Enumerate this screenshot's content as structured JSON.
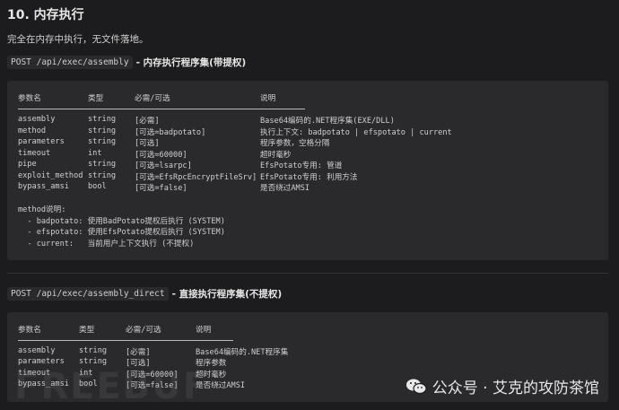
{
  "heading": "10. 内存执行",
  "desc": "完全在内存中执行，无文件落地。",
  "endpoints": [
    {
      "path": "POST /api/exec/assembly",
      "title": "- 内存执行程序集(带提权)",
      "headers": [
        "参数名",
        "类型",
        "必需/可选",
        "说明"
      ],
      "rows": [
        [
          "assembly",
          "string",
          "[必需]",
          "Base64编码的.NET程序集(EXE/DLL)"
        ],
        [
          "method",
          "string",
          "[可选=badpotato]",
          "执行上下文: badpotato | efspotato | current"
        ],
        [
          "parameters",
          "string",
          "[可选]",
          "程序参数，空格分隔"
        ],
        [
          "timeout",
          "int",
          "[可选=60000]",
          "超时毫秒"
        ],
        [
          "pipe",
          "string",
          "[可选=lsarpc]",
          "EfsPotato专用: 管道"
        ],
        [
          "exploit_method",
          "string",
          "[可选=EfsRpcEncryptFileSrv]",
          "EfsPotato专用: 利用方法"
        ],
        [
          "bypass_amsi",
          "bool",
          "[可选=false]",
          "是否绕过AMSI"
        ]
      ],
      "notes": [
        "method说明:",
        "  - badpotato: 使用BadPotato提权后执行 (SYSTEM)",
        "  - efspotato: 使用EfsPotato提权后执行 (SYSTEM)",
        "  - current:   当前用户上下文执行 (不提权)"
      ]
    },
    {
      "path": "POST /api/exec/assembly_direct",
      "title": "- 直接执行程序集(不提权)",
      "headers": [
        "参数名",
        "类型",
        "必需/可选",
        "说明"
      ],
      "rows": [
        [
          "assembly",
          "string",
          "[必需]",
          "Base64编码的.NET程序集"
        ],
        [
          "parameters",
          "string",
          "[可选]",
          "程序参数"
        ],
        [
          "timeout",
          "int",
          "[可选=60000]",
          "超时毫秒"
        ],
        [
          "bypass_amsi",
          "bool",
          "[可选=false]",
          "是否绕过AMSI"
        ]
      ]
    }
  ],
  "watermark": "公众号 · 艾克的攻防茶馆",
  "logo_text": "FREEBUF"
}
